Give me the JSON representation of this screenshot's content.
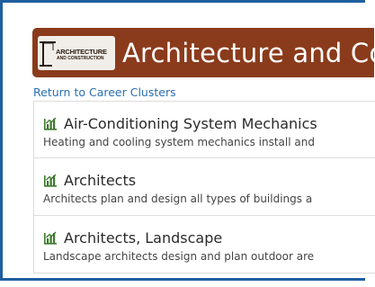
{
  "banner": {
    "logo_text_main": "ARCHITECTURE",
    "logo_text_sub": "AND CONSTRUCTION",
    "title": "Architecture and Co"
  },
  "nav": {
    "return_link": "Return to Career Clusters"
  },
  "careers": [
    {
      "title": "Air-Conditioning System Mechanics",
      "description": "Heating and cooling system mechanics install and"
    },
    {
      "title": "Architects",
      "description": "Architects plan and design all types of buildings a"
    },
    {
      "title": "Architects, Landscape",
      "description": "Landscape architects design and plan outdoor are"
    }
  ],
  "colors": {
    "banner": "#8a3b1c",
    "link": "#2a6fb3",
    "icon": "#3c7a2b",
    "frame": "#1f5f9f"
  },
  "icons": {
    "career_icon": "bar-chart-icon",
    "logo": "crane-logo"
  }
}
